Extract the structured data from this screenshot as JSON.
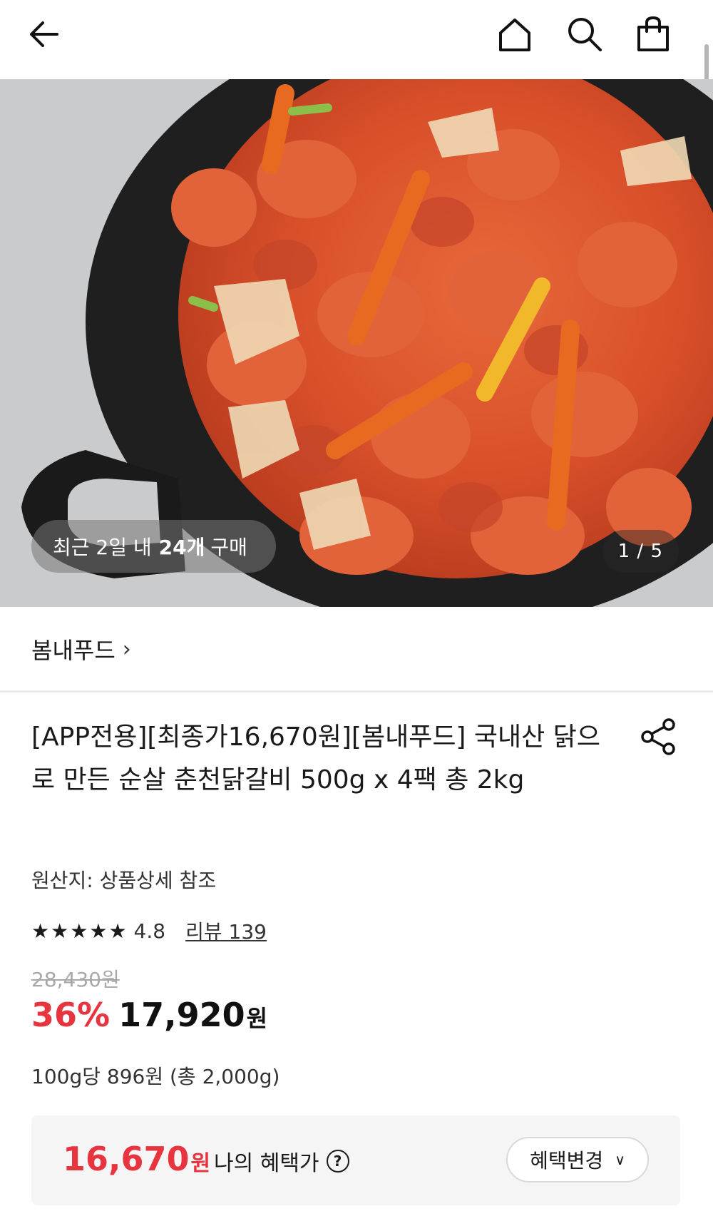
{
  "header": {
    "back_icon": "arrow-left-icon",
    "home_icon": "home-icon",
    "search_icon": "search-icon",
    "cart_icon": "shopping-bag-icon"
  },
  "hero": {
    "recent_prefix": "최근 2일 내",
    "recent_count": "24개",
    "recent_suffix": "구매",
    "image_counter": "1 / 5"
  },
  "brand": {
    "name": "봄내푸드",
    "chevron": "›"
  },
  "product": {
    "title": "[APP전용][최종가16,670원][봄내푸드] 국내산 닭으로 만든 순살 춘천닭갈비 500g x 4팩 총 2kg",
    "origin": "원산지: 상품상세 참조",
    "rating": "4.8",
    "stars": 5,
    "review_label": "리뷰 139",
    "original_price": "28,430원",
    "discount": "36%",
    "price": "17,920",
    "currency": "원",
    "unit_price": "100g당 896원 (총 2,000g)"
  },
  "benefit": {
    "price": "16,670",
    "currency": "원",
    "label": "나의 혜택가",
    "help_icon": "?",
    "button_label": "혜택변경",
    "button_chevron": "∨"
  },
  "colors": {
    "accent_red": "#e8343f",
    "strike_gray": "#a8a8a8",
    "benefit_bg": "#f5f5f5"
  }
}
